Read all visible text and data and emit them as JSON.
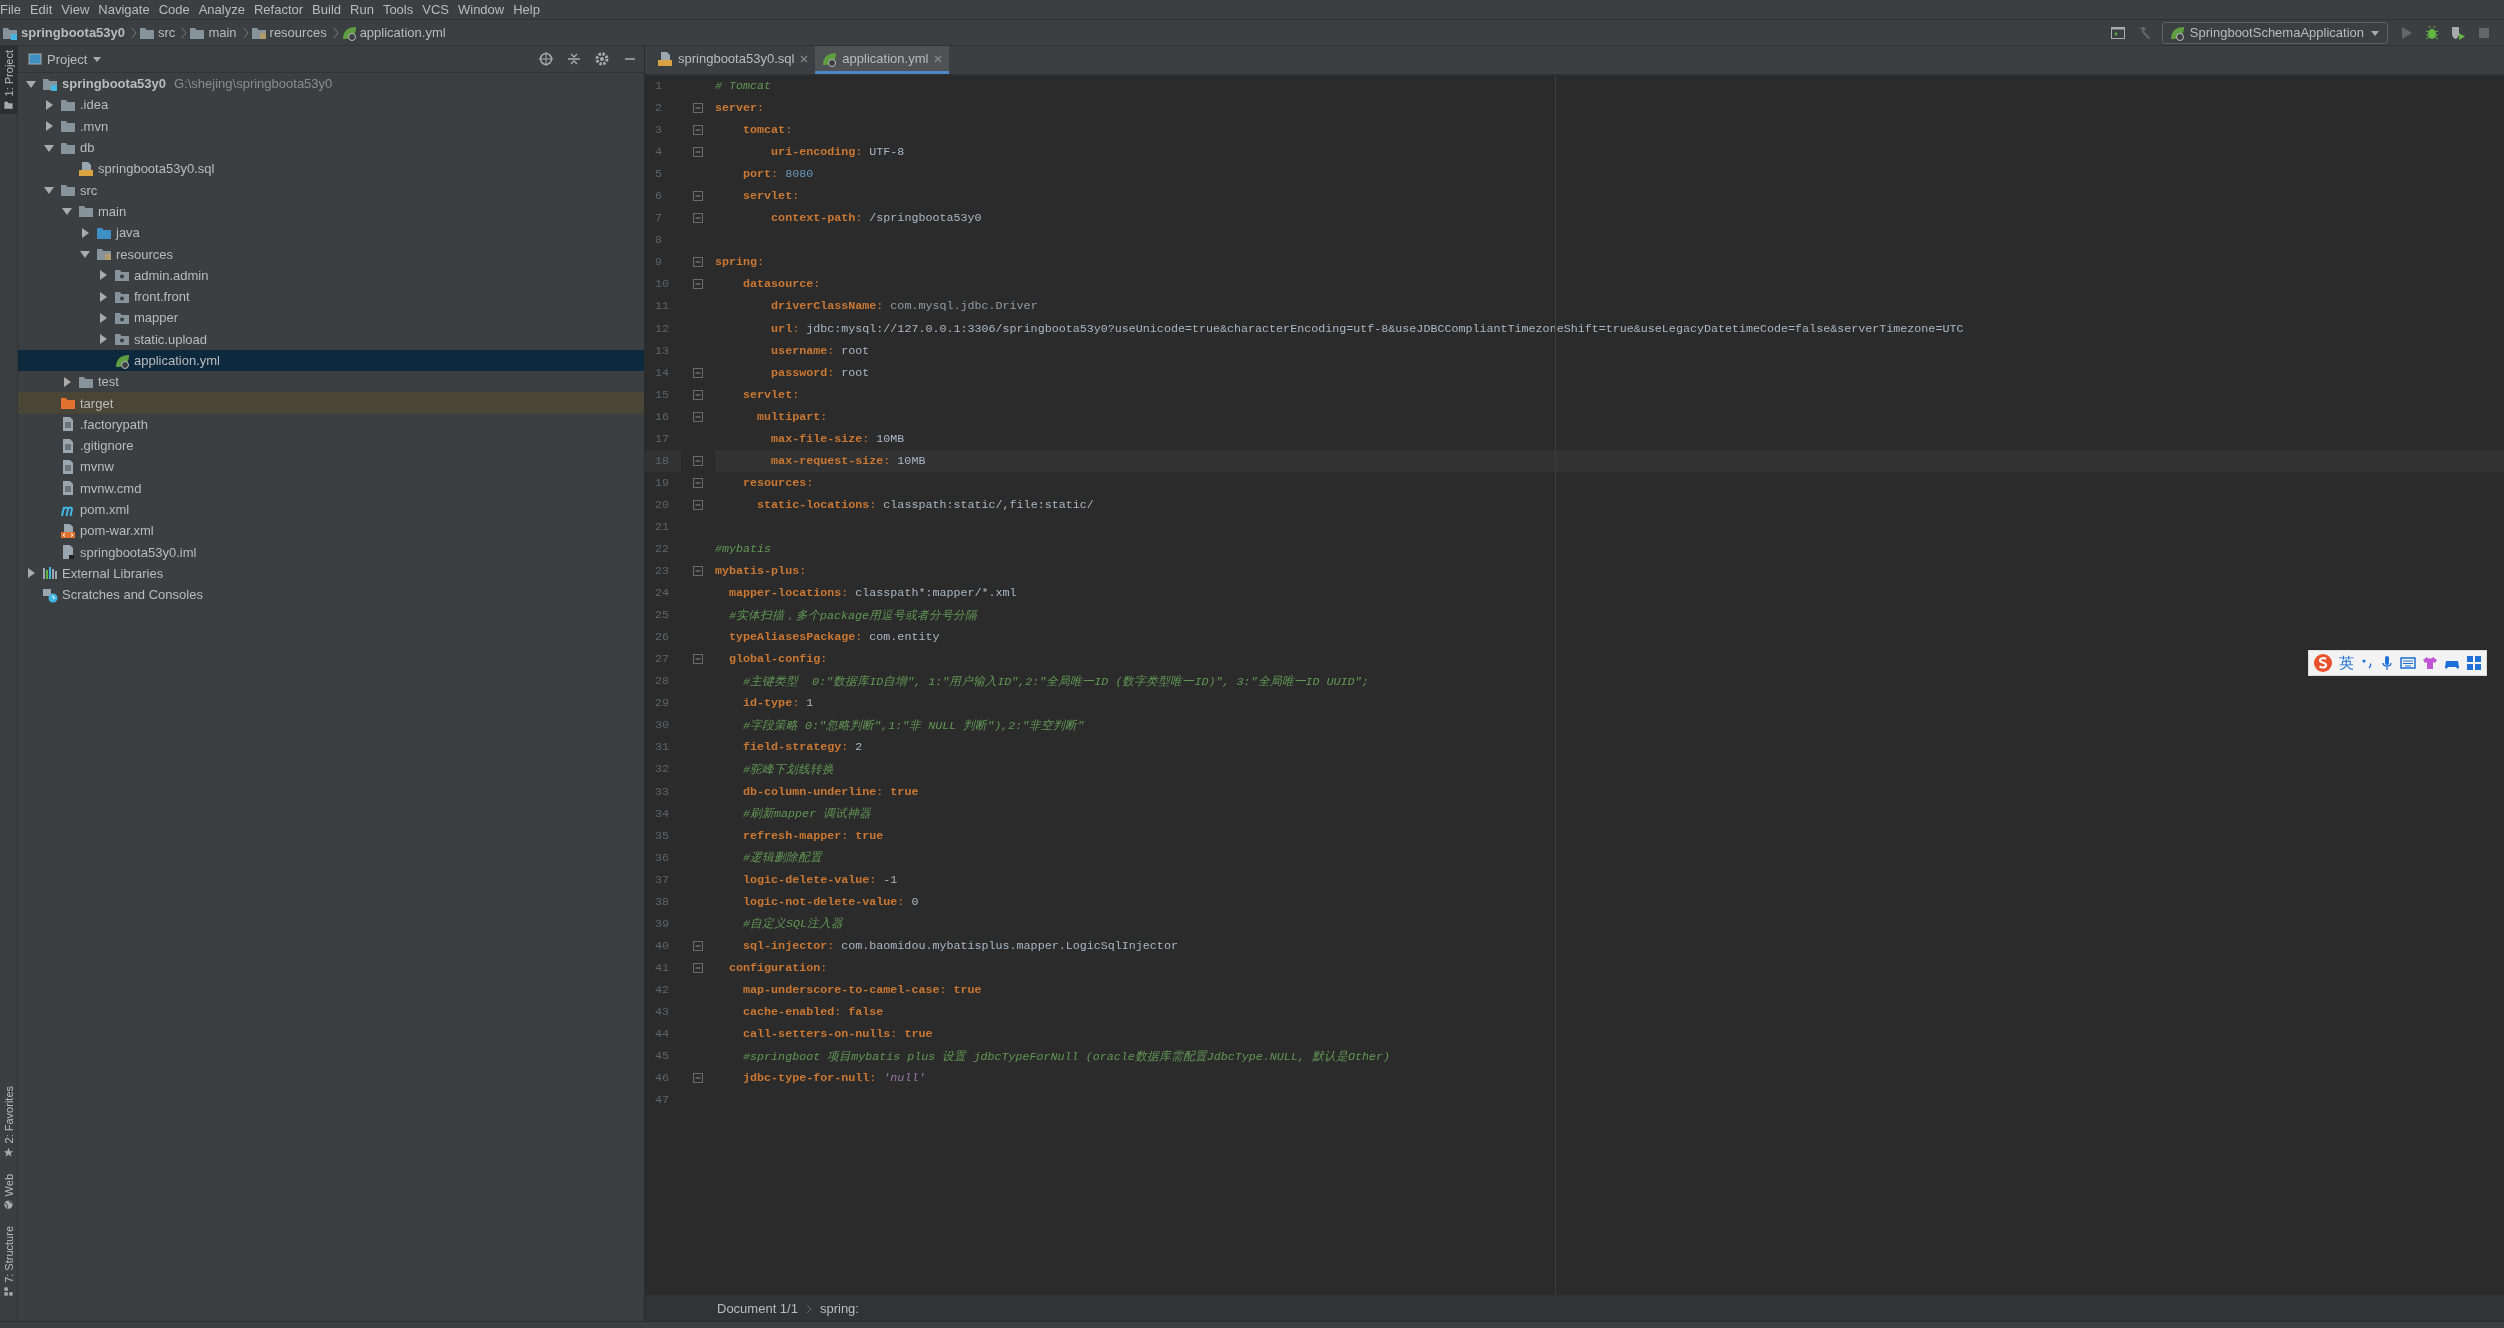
{
  "menu": [
    "File",
    "Edit",
    "View",
    "Navigate",
    "Code",
    "Analyze",
    "Refactor",
    "Build",
    "Run",
    "Tools",
    "VCS",
    "Window",
    "Help"
  ],
  "navbar": {
    "crumbs": [
      {
        "label": "springboota53y0",
        "kind": "module"
      },
      {
        "label": "src",
        "kind": "folder"
      },
      {
        "label": "main",
        "kind": "folder"
      },
      {
        "label": "resources",
        "kind": "resources"
      },
      {
        "label": "application.yml",
        "kind": "yml"
      }
    ],
    "run_config": "SpringbootSchemaApplication"
  },
  "tool_stripe": {
    "top": [
      {
        "label": "1: Project",
        "kind": "project",
        "selected": true
      }
    ],
    "bottom": [
      {
        "label": "2: Favorites",
        "kind": "favorites",
        "selected": false
      },
      {
        "label": "Web",
        "kind": "web",
        "selected": false
      },
      {
        "label": "7: Structure",
        "kind": "structure",
        "selected": false
      }
    ]
  },
  "project": {
    "title": "Project",
    "tree": [
      {
        "label": "springboota53y0",
        "kind": "module",
        "hint": "G:\\shejing\\springboota53y0",
        "expanded": true,
        "selected": false,
        "children": [
          {
            "label": ".idea",
            "kind": "folder",
            "expanded": false,
            "selected": false
          },
          {
            "label": ".mvn",
            "kind": "folder",
            "expanded": false,
            "selected": false
          },
          {
            "label": "db",
            "kind": "folder",
            "expanded": true,
            "selected": false,
            "children": [
              {
                "label": "springboota53y0.sql",
                "kind": "sql",
                "selected": false
              }
            ]
          },
          {
            "label": "src",
            "kind": "folder",
            "expanded": true,
            "selected": false,
            "children": [
              {
                "label": "main",
                "kind": "folder",
                "expanded": true,
                "selected": false,
                "children": [
                  {
                    "label": "java",
                    "kind": "source",
                    "expanded": false,
                    "selected": false
                  },
                  {
                    "label": "resources",
                    "kind": "resources",
                    "expanded": true,
                    "selected": false,
                    "children": [
                      {
                        "label": "admin.admin",
                        "kind": "package",
                        "expanded": false,
                        "selected": false
                      },
                      {
                        "label": "front.front",
                        "kind": "package",
                        "expanded": false,
                        "selected": false
                      },
                      {
                        "label": "mapper",
                        "kind": "package",
                        "expanded": false,
                        "selected": false
                      },
                      {
                        "label": "static.upload",
                        "kind": "package",
                        "expanded": false,
                        "selected": false
                      },
                      {
                        "label": "application.yml",
                        "kind": "yml",
                        "selected": true
                      }
                    ]
                  }
                ]
              },
              {
                "label": "test",
                "kind": "folder",
                "expanded": false,
                "selected": false
              }
            ]
          },
          {
            "label": "target",
            "kind": "excluded",
            "selected": false
          },
          {
            "label": ".factorypath",
            "kind": "file",
            "selected": false
          },
          {
            "label": ".gitignore",
            "kind": "file",
            "selected": false
          },
          {
            "label": "mvnw",
            "kind": "file",
            "selected": false
          },
          {
            "label": "mvnw.cmd",
            "kind": "file",
            "selected": false
          },
          {
            "label": "pom.xml",
            "kind": "maven",
            "selected": false
          },
          {
            "label": "pom-war.xml",
            "kind": "xml",
            "selected": false
          },
          {
            "label": "springboota53y0.iml",
            "kind": "iml",
            "selected": false
          }
        ]
      },
      {
        "label": "External Libraries",
        "kind": "libraries",
        "expanded": false,
        "selected": false
      },
      {
        "label": "Scratches and Consoles",
        "kind": "scratches",
        "selected": false
      }
    ]
  },
  "editor": {
    "tabs": [
      {
        "label": "springboota53y0.sql",
        "kind": "sql",
        "selected": false
      },
      {
        "label": "application.yml",
        "kind": "yml",
        "selected": true
      }
    ],
    "lines": [
      {
        "number": "1",
        "tokens": [
          {
            "kind": "comment",
            "text": "# Tomcat"
          }
        ]
      },
      {
        "number": "2",
        "fold": true,
        "tokens": [
          {
            "kind": "key",
            "text": "server"
          },
          {
            "kind": "punct",
            "text": ":"
          }
        ]
      },
      {
        "number": "3",
        "fold": true,
        "tokens": [
          {
            "kind": "key",
            "text": "    tomcat"
          },
          {
            "kind": "punct",
            "text": ":"
          }
        ]
      },
      {
        "number": "4",
        "fold": true,
        "tokens": [
          {
            "kind": "key",
            "text": "        uri-encoding"
          },
          {
            "kind": "punct",
            "text": ": "
          },
          {
            "kind": "plain",
            "text": "UTF-8"
          }
        ]
      },
      {
        "number": "5",
        "tokens": [
          {
            "kind": "key",
            "text": "    port"
          },
          {
            "kind": "punct",
            "text": ": "
          },
          {
            "kind": "number",
            "text": "8080"
          }
        ]
      },
      {
        "number": "6",
        "fold": true,
        "tokens": [
          {
            "kind": "key",
            "text": "    servlet"
          },
          {
            "kind": "punct",
            "text": ":"
          }
        ]
      },
      {
        "number": "7",
        "fold": true,
        "tokens": [
          {
            "kind": "key",
            "text": "        context-path"
          },
          {
            "kind": "punct",
            "text": ": "
          },
          {
            "kind": "plain",
            "text": "/springboota53y0"
          }
        ]
      },
      {
        "number": "8"
      },
      {
        "number": "9",
        "fold": true,
        "tokens": [
          {
            "kind": "key",
            "text": "spring"
          },
          {
            "kind": "punct",
            "text": ":"
          }
        ]
      },
      {
        "number": "10",
        "fold": true,
        "tokens": [
          {
            "kind": "key",
            "text": "    datasource"
          },
          {
            "kind": "punct",
            "text": ":"
          }
        ]
      },
      {
        "number": "11",
        "tokens": [
          {
            "kind": "key",
            "text": "        driverClassName"
          },
          {
            "kind": "punct",
            "text": ": "
          },
          {
            "kind": "dim",
            "text": "com.mysql.jdbc.Driver"
          }
        ]
      },
      {
        "number": "12",
        "tokens": [
          {
            "kind": "key",
            "text": "        url"
          },
          {
            "kind": "punct",
            "text": ": "
          },
          {
            "kind": "plain",
            "text": "jdbc:mysql://127.0.0.1:3306/springboota53y0?useUnicode=true&characterEncoding=utf-8&useJDBCCompliantTimezoneShift=true&useLegacyDatetimeCode=false&serverTimezone=UTC"
          }
        ]
      },
      {
        "number": "13",
        "tokens": [
          {
            "kind": "key",
            "text": "        username"
          },
          {
            "kind": "punct",
            "text": ": "
          },
          {
            "kind": "plain",
            "text": "root"
          }
        ]
      },
      {
        "number": "14",
        "fold": true,
        "tokens": [
          {
            "kind": "key",
            "text": "        password"
          },
          {
            "kind": "punct",
            "text": ": "
          },
          {
            "kind": "plain",
            "text": "root"
          }
        ]
      },
      {
        "number": "15",
        "fold": true,
        "tokens": [
          {
            "kind": "key",
            "text": "    servlet"
          },
          {
            "kind": "punct",
            "text": ":"
          }
        ]
      },
      {
        "number": "16",
        "fold": true,
        "tokens": [
          {
            "kind": "key",
            "text": "      multipart"
          },
          {
            "kind": "punct",
            "text": ":"
          }
        ]
      },
      {
        "number": "17",
        "tokens": [
          {
            "kind": "key",
            "text": "        max-file-size"
          },
          {
            "kind": "punct",
            "text": ": "
          },
          {
            "kind": "plain",
            "text": "10MB"
          }
        ]
      },
      {
        "number": "18",
        "current": true,
        "fold": true,
        "tokens": [
          {
            "kind": "key",
            "text": "        max-request-size"
          },
          {
            "kind": "punct",
            "text": ": "
          },
          {
            "kind": "plain",
            "text": "10MB"
          }
        ]
      },
      {
        "number": "19",
        "fold": true,
        "tokens": [
          {
            "kind": "key",
            "text": "    resources"
          },
          {
            "kind": "punct",
            "text": ":"
          }
        ]
      },
      {
        "number": "20",
        "fold": true,
        "tokens": [
          {
            "kind": "key",
            "text": "      static-locations"
          },
          {
            "kind": "punct",
            "text": ": "
          },
          {
            "kind": "plain",
            "text": "classpath:static/,file:static/"
          }
        ]
      },
      {
        "number": "21"
      },
      {
        "number": "22",
        "tokens": [
          {
            "kind": "comment",
            "text": "#mybatis"
          }
        ]
      },
      {
        "number": "23",
        "fold": true,
        "tokens": [
          {
            "kind": "key",
            "text": "mybatis-plus"
          },
          {
            "kind": "punct",
            "text": ":"
          }
        ]
      },
      {
        "number": "24",
        "tokens": [
          {
            "kind": "key",
            "text": "  mapper-locations"
          },
          {
            "kind": "punct",
            "text": ": "
          },
          {
            "kind": "plain",
            "text": "classpath*:mapper/*.xml"
          }
        ]
      },
      {
        "number": "25",
        "tokens": [
          {
            "kind": "comment",
            "text": "  #实体扫描，多个package用逗号或者分号分隔"
          }
        ]
      },
      {
        "number": "26",
        "tokens": [
          {
            "kind": "key",
            "text": "  typeAliasesPackage"
          },
          {
            "kind": "punct",
            "text": ": "
          },
          {
            "kind": "plain",
            "text": "com.entity"
          }
        ]
      },
      {
        "number": "27",
        "fold": true,
        "tokens": [
          {
            "kind": "key",
            "text": "  global-config"
          },
          {
            "kind": "punct",
            "text": ":"
          }
        ]
      },
      {
        "number": "28",
        "tokens": [
          {
            "kind": "comment",
            "text": "    #主键类型  0:\"数据库ID自增\", 1:\"用户输入ID\",2:\"全局唯一ID (数字类型唯一ID)\", 3:\"全局唯一ID UUID\";"
          }
        ]
      },
      {
        "number": "29",
        "tokens": [
          {
            "kind": "key",
            "text": "    id-type"
          },
          {
            "kind": "punct",
            "text": ": "
          },
          {
            "kind": "plain",
            "text": "1"
          }
        ]
      },
      {
        "number": "30",
        "tokens": [
          {
            "kind": "comment",
            "text": "    #字段策略 0:\"忽略判断\",1:\"非 NULL 判断\"),2:\"非空判断\""
          }
        ]
      },
      {
        "number": "31",
        "tokens": [
          {
            "kind": "key",
            "text": "    field-strategy"
          },
          {
            "kind": "punct",
            "text": ": "
          },
          {
            "kind": "plain",
            "text": "2"
          }
        ]
      },
      {
        "number": "32",
        "tokens": [
          {
            "kind": "comment",
            "text": "    #驼峰下划线转换"
          }
        ]
      },
      {
        "number": "33",
        "tokens": [
          {
            "kind": "key",
            "text": "    db-column-underline"
          },
          {
            "kind": "punct",
            "text": ": "
          },
          {
            "kind": "keyword",
            "text": "true"
          }
        ]
      },
      {
        "number": "34",
        "tokens": [
          {
            "kind": "comment",
            "text": "    #刷新mapper 调试神器"
          }
        ]
      },
      {
        "number": "35",
        "tokens": [
          {
            "kind": "key",
            "text": "    refresh-mapper"
          },
          {
            "kind": "punct",
            "text": ": "
          },
          {
            "kind": "keyword",
            "text": "true"
          }
        ]
      },
      {
        "number": "36",
        "tokens": [
          {
            "kind": "comment",
            "text": "    #逻辑删除配置"
          }
        ]
      },
      {
        "number": "37",
        "tokens": [
          {
            "kind": "key",
            "text": "    logic-delete-value"
          },
          {
            "kind": "punct",
            "text": ": "
          },
          {
            "kind": "plain",
            "text": "-1"
          }
        ]
      },
      {
        "number": "38",
        "tokens": [
          {
            "kind": "key",
            "text": "    logic-not-delete-value"
          },
          {
            "kind": "punct",
            "text": ": "
          },
          {
            "kind": "plain",
            "text": "0"
          }
        ]
      },
      {
        "number": "39",
        "tokens": [
          {
            "kind": "comment",
            "text": "    #自定义SQL注入器"
          }
        ]
      },
      {
        "number": "40",
        "fold": true,
        "tokens": [
          {
            "kind": "key",
            "text": "    sql-injector"
          },
          {
            "kind": "punct",
            "text": ": "
          },
          {
            "kind": "plain",
            "text": "com.baomidou.mybatisplus.mapper.LogicSqlInjector"
          }
        ]
      },
      {
        "number": "41",
        "fold": true,
        "tokens": [
          {
            "kind": "key",
            "text": "  configuration"
          },
          {
            "kind": "punct",
            "text": ":"
          }
        ]
      },
      {
        "number": "42",
        "tokens": [
          {
            "kind": "key",
            "text": "    map-underscore-to-camel-case"
          },
          {
            "kind": "punct",
            "text": ": "
          },
          {
            "kind": "keyword",
            "text": "true"
          }
        ]
      },
      {
        "number": "43",
        "tokens": [
          {
            "kind": "key",
            "text": "    cache-enabled"
          },
          {
            "kind": "punct",
            "text": ": "
          },
          {
            "kind": "keyword",
            "text": "false"
          }
        ]
      },
      {
        "number": "44",
        "tokens": [
          {
            "kind": "key",
            "text": "    call-setters-on-nulls"
          },
          {
            "kind": "punct",
            "text": ": "
          },
          {
            "kind": "keyword",
            "text": "true"
          }
        ]
      },
      {
        "number": "45",
        "tokens": [
          {
            "kind": "comment",
            "text": "    #springboot 项目mybatis plus 设置 jdbcTypeForNull (oracle数据库需配置JdbcType.NULL, 默认是Other)"
          }
        ]
      },
      {
        "number": "46",
        "fold": true,
        "tokens": [
          {
            "kind": "key",
            "text": "    jdbc-type-for-null"
          },
          {
            "kind": "punct",
            "text": ": "
          },
          {
            "kind": "string",
            "text": "'null'"
          }
        ]
      },
      {
        "number": "47"
      }
    ],
    "breadcrumbs": [
      "Document 1/1",
      "spring:"
    ]
  },
  "ime": {
    "mode": "英"
  }
}
